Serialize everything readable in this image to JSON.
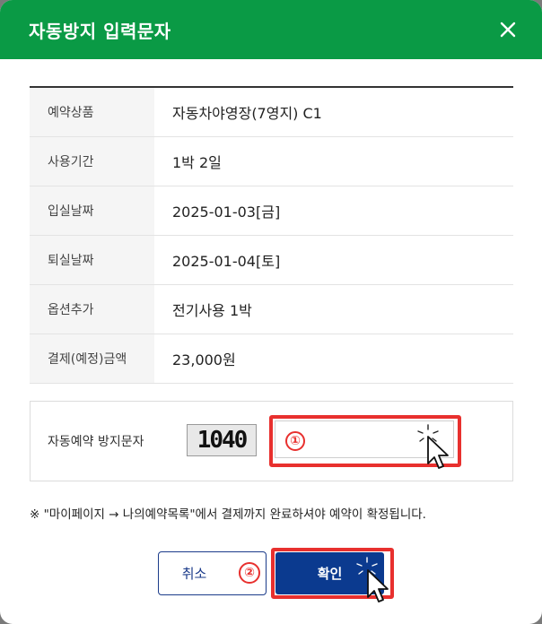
{
  "dialog": {
    "title": "자동방지 입력문자"
  },
  "info_rows": [
    {
      "label": "예약상품",
      "value": "자동차야영장(7영지) C1"
    },
    {
      "label": "사용기간",
      "value": "1박 2일"
    },
    {
      "label": "입실날짜",
      "value": "2025-01-03[금]"
    },
    {
      "label": "퇴실날짜",
      "value": "2025-01-04[토]"
    },
    {
      "label": "옵션추가",
      "value": "전기사용 1박"
    },
    {
      "label": "결제(예정)금액",
      "value": "23,000원"
    }
  ],
  "captcha": {
    "label": "자동예약 방지문자",
    "code": "1040",
    "input_value": "",
    "step_marker": "①"
  },
  "notice": "※ \"마이페이지 → 나의예약목록\"에서 결제까지 완료하셔야 예약이 확정됩니다.",
  "buttons": {
    "cancel_label": "취소",
    "cancel_marker": "②",
    "confirm_label": "확인"
  },
  "colors": {
    "header": "#0a9a45",
    "highlight": "#e8302e",
    "confirm": "#0b3a8f"
  }
}
